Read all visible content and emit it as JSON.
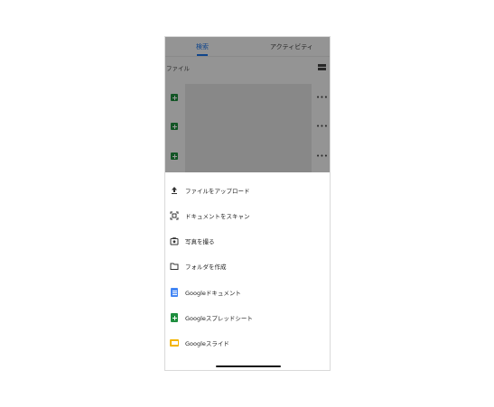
{
  "tabs": {
    "left": "検索",
    "right": "アクティビティ"
  },
  "section": {
    "title": "ファイル"
  },
  "file_rows": [
    {
      "more": "•••"
    },
    {
      "more": "•••"
    },
    {
      "more": "•••"
    }
  ],
  "menu": {
    "items": [
      {
        "label": "ファイルをアップロード",
        "icon": "upload-icon"
      },
      {
        "label": "ドキュメントをスキャン",
        "icon": "scan-icon"
      },
      {
        "label": "写真を撮る",
        "icon": "camera-icon"
      },
      {
        "label": "フォルダを作成",
        "icon": "folder-icon"
      },
      {
        "label": "Googleドキュメント",
        "icon": "google-docs-icon"
      },
      {
        "label": "Googleスプレッドシート",
        "icon": "google-sheets-icon"
      },
      {
        "label": "Googleスライド",
        "icon": "google-slides-icon"
      }
    ]
  },
  "colors": {
    "accent": "#1a73e8",
    "docs": "#4285f4",
    "sheets": "#1e8e3e",
    "slides": "#f4b400"
  }
}
